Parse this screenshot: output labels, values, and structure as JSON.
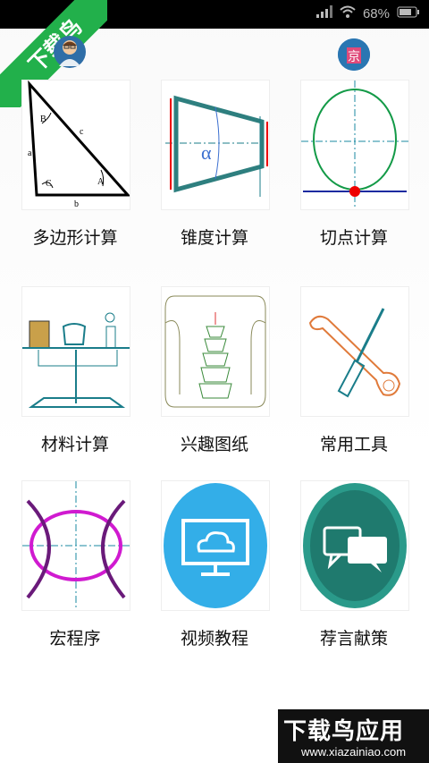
{
  "status_bar": {
    "battery": "68%",
    "icons": [
      "signal-icon",
      "wifi-icon",
      "battery-icon"
    ]
  },
  "watermark": {
    "text": "下载鸟"
  },
  "header": {
    "left_avatar": "user-avatar",
    "right_avatar": "app-logo-avatar"
  },
  "menu": [
    {
      "label": "多边形计算",
      "icon": "triangle-diagram"
    },
    {
      "label": "锥度计算",
      "icon": "taper-diagram"
    },
    {
      "label": "切点计算",
      "icon": "tangent-point-diagram"
    },
    {
      "label": "材料计算",
      "icon": "balance-scale-diagram"
    },
    {
      "label": "兴趣图纸",
      "icon": "pagoda-scroll-drawing"
    },
    {
      "label": "常用工具",
      "icon": "wrench-screwdriver"
    },
    {
      "label": "宏程序",
      "icon": "macro-curves-diagram"
    },
    {
      "label": "视频教程",
      "icon": "cloud-monitor-icon"
    },
    {
      "label": "荐言献策",
      "icon": "chat-bubbles-icon"
    }
  ],
  "triangle_labels": {
    "a": "a",
    "b": "b",
    "c": "c",
    "A": "A",
    "B": "B",
    "C": "C"
  },
  "taper_label": "α",
  "footer_watermark": {
    "brand": "下载鸟应用",
    "url": "www.xiazainiao.com"
  }
}
